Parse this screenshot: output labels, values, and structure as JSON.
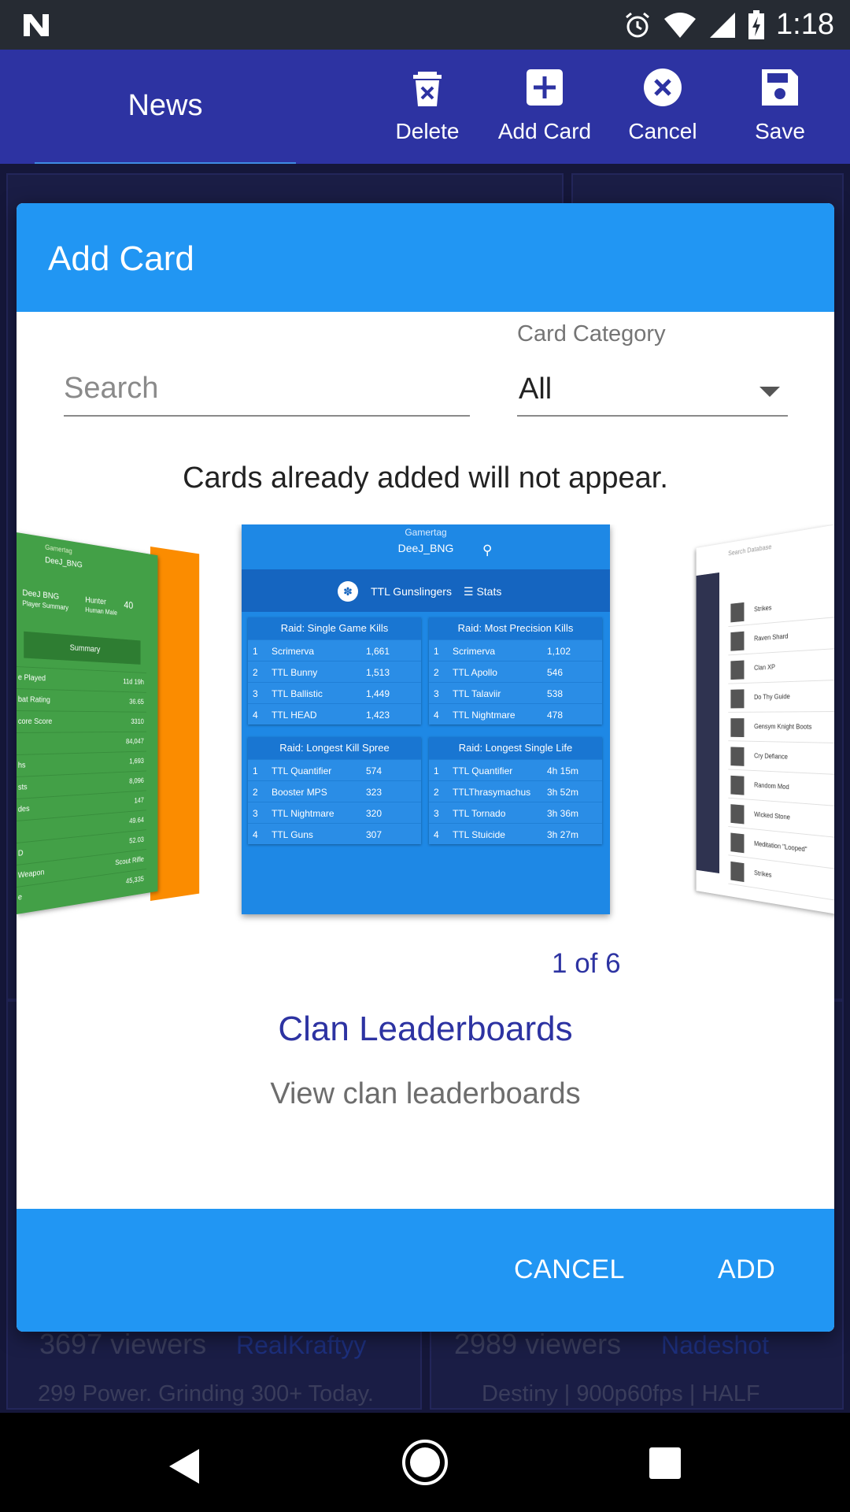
{
  "status_bar": {
    "time": "1:18",
    "icons": [
      "notification-n-icon",
      "alarm-icon",
      "wifi-icon",
      "signal-icon",
      "battery-charging-icon"
    ]
  },
  "app_bar": {
    "tab_label": "News",
    "actions": [
      {
        "label": "Delete",
        "icon": "delete-icon"
      },
      {
        "label": "Add Card",
        "icon": "add-box-icon"
      },
      {
        "label": "Cancel",
        "icon": "cancel-icon"
      },
      {
        "label": "Save",
        "icon": "save-icon"
      }
    ],
    "colors": {
      "bar": "#2d33a2",
      "underline": "#3f8be3"
    }
  },
  "background": {
    "cards": [
      {
        "viewers": "3697 viewers",
        "streamer": "RealKraftyy",
        "title": "299 Power. Grinding 300+ Today."
      },
      {
        "viewers": "2989 viewers",
        "streamer": "Nadeshot",
        "title": "Destiny | 900p60fps | HALF"
      }
    ]
  },
  "dialog": {
    "title": "Add Card",
    "search_placeholder": "Search",
    "category_label": "Card Category",
    "category_value": "All",
    "notice": "Cards already added will not appear.",
    "pager": "1 of 6",
    "card_title": "Clan Leaderboards",
    "card_description": "View clan leaderboards",
    "cancel_label": "CANCEL",
    "add_label": "ADD",
    "colors": {
      "header": "#2196f3",
      "accent_text": "#2d33a2"
    }
  },
  "preview": {
    "gamertag_label": "Gamertag",
    "gamertag": "DeeJ_BNG",
    "clan_name": "TTL Gunslingers",
    "stats_label": "Stats",
    "boards": [
      {
        "title": "Raid: Single Game Kills",
        "rows": [
          {
            "rank": "1",
            "name": "Scrimerva",
            "value": "1,661"
          },
          {
            "rank": "2",
            "name": "TTL Bunny",
            "value": "1,513"
          },
          {
            "rank": "3",
            "name": "TTL Ballistic",
            "value": "1,449"
          },
          {
            "rank": "4",
            "name": "TTL HEAD",
            "value": "1,423"
          }
        ]
      },
      {
        "title": "Raid: Most Precision Kills",
        "rows": [
          {
            "rank": "1",
            "name": "Scrimerva",
            "value": "1,102"
          },
          {
            "rank": "2",
            "name": "TTL Apollo",
            "value": "546"
          },
          {
            "rank": "3",
            "name": "TTL Talaviir",
            "value": "538"
          },
          {
            "rank": "4",
            "name": "TTL Nightmare",
            "value": "478"
          }
        ]
      },
      {
        "title": "Raid: Longest Kill Spree",
        "rows": [
          {
            "rank": "1",
            "name": "TTL Quantifier",
            "value": "574"
          },
          {
            "rank": "2",
            "name": "Booster MPS",
            "value": "323"
          },
          {
            "rank": "3",
            "name": "TTL Nightmare",
            "value": "320"
          },
          {
            "rank": "4",
            "name": "TTL Guns",
            "value": "307"
          }
        ]
      },
      {
        "title": "Raid: Longest Single Life",
        "rows": [
          {
            "rank": "1",
            "name": "TTL Quantifier",
            "value": "4h 15m"
          },
          {
            "rank": "2",
            "name": "TTLThrasymachus",
            "value": "3h 52m"
          },
          {
            "rank": "3",
            "name": "TTL Tornado",
            "value": "3h 36m"
          },
          {
            "rank": "4",
            "name": "TTL Stuicide",
            "value": "3h 27m"
          }
        ]
      }
    ],
    "left_preview": {
      "gamertag_label": "Gamertag",
      "gamertag": "DeeJ_BNG",
      "player": "DeeJ BNG",
      "player_sub": "Player Summary",
      "class": "Hunter",
      "class_sub": "Human Male",
      "level": "40",
      "summary_label": "Summary",
      "rows": [
        {
          "label": "e Played",
          "value": "11d 19h"
        },
        {
          "label": "bat Rating",
          "value": "36.65"
        },
        {
          "label": "core Score",
          "value": "3310"
        },
        {
          "label": "",
          "value": "84,047"
        },
        {
          "label": "hs",
          "value": "1,693"
        },
        {
          "label": "sts",
          "value": "8,096"
        },
        {
          "label": "des",
          "value": "147"
        },
        {
          "label": "",
          "value": "49.64"
        },
        {
          "label": "D",
          "value": "52.03"
        },
        {
          "label": "Weapon",
          "value": "Scout Rifle"
        },
        {
          "label": "e",
          "value": "45,335"
        }
      ]
    },
    "right_preview": {
      "search_placeholder": "Search Database",
      "rows": [
        "Strikes",
        "Raven Shard",
        "Clan XP",
        "Do Thy Guide",
        "Gensym Knight Boots",
        "Cry Defiance",
        "Random Mod",
        "Wicked Stone",
        "Meditation \"Looped\"",
        "Strikes"
      ]
    }
  }
}
